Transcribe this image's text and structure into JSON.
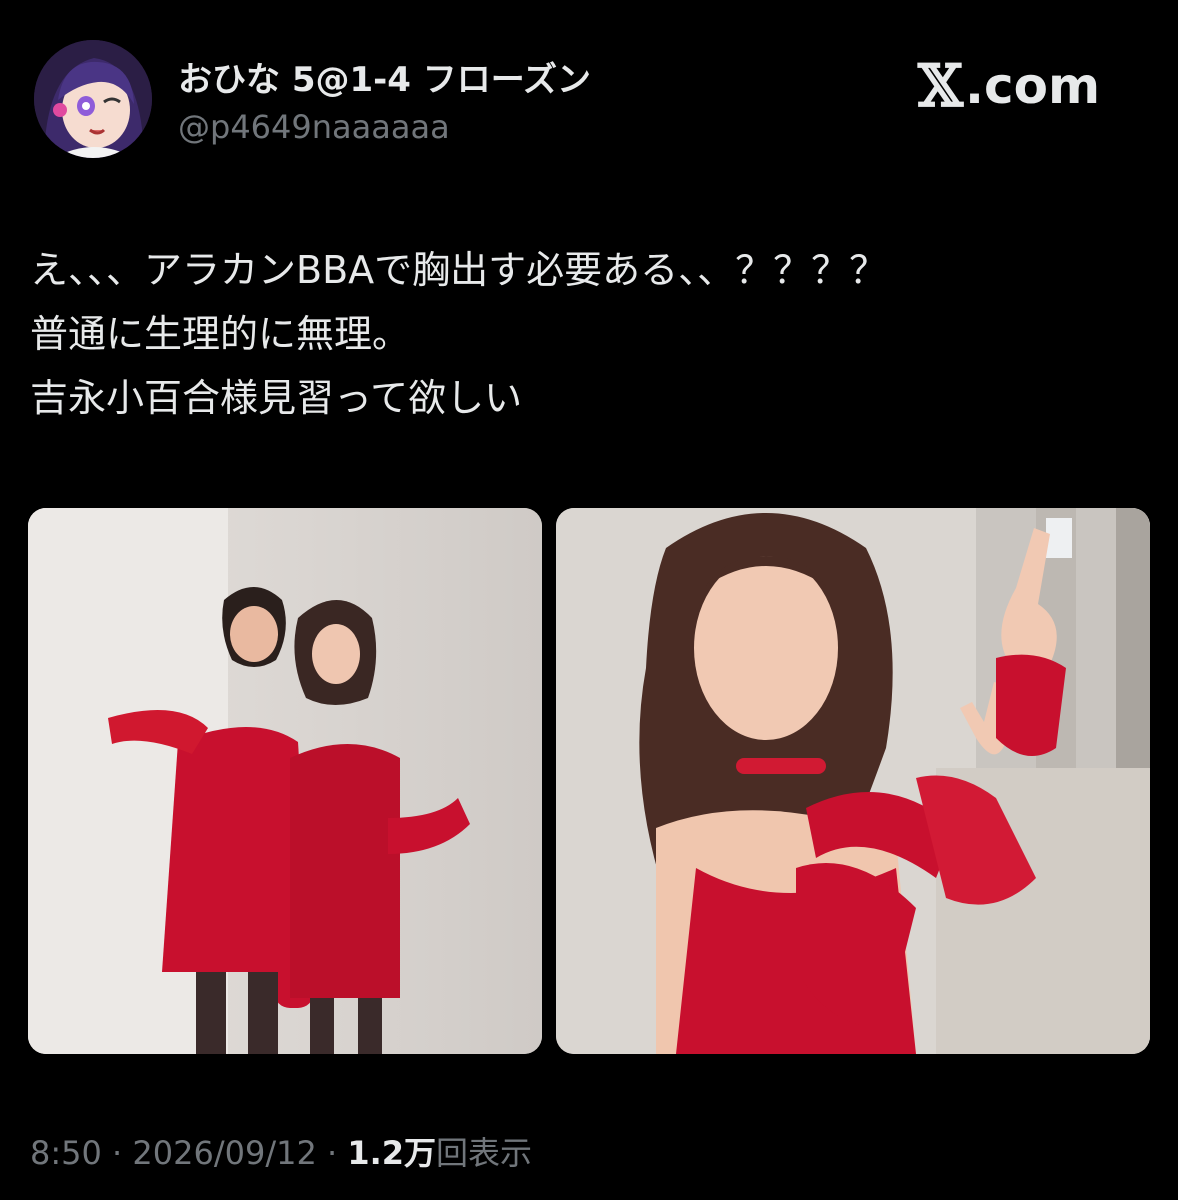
{
  "user": {
    "display_name": "おひな 5@1-4 フローズン",
    "handle": "@p4649naaaaaa"
  },
  "brand": {
    "logo_mark": "𝕏",
    "logo_text": ".com"
  },
  "tweet": {
    "lines": [
      "え、、、アラカンBBAで胸出す必要ある、、？？？？",
      "普通に生理的に無理。",
      "吉永小百合様見習って欲しい"
    ]
  },
  "meta": {
    "time": "8:50",
    "separator": " · ",
    "date": "2026/09/12",
    "views_count": "1.2",
    "views_unit": "万",
    "views_label": "回表示"
  },
  "colors": {
    "background": "#000000",
    "text": "#e7e9ea",
    "muted": "#71767b",
    "dress_red": "#c8102e"
  }
}
